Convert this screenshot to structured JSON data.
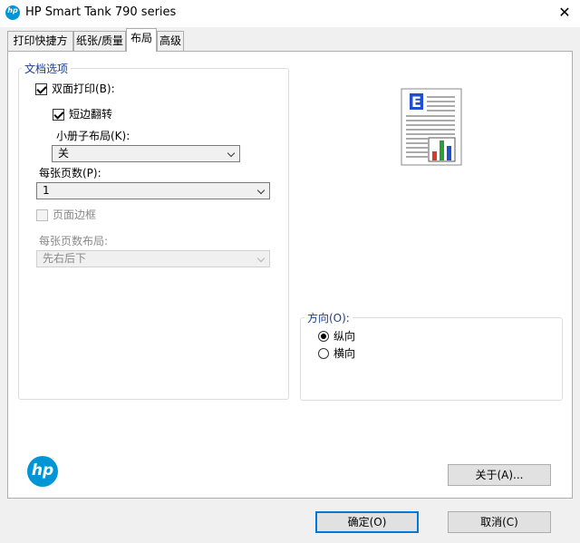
{
  "window": {
    "title": "HP Smart Tank 790 series",
    "logo_text": "hp"
  },
  "tabs": [
    {
      "label": "打印快捷方式"
    },
    {
      "label": "纸张/质量"
    },
    {
      "label": "布局"
    },
    {
      "label": "高级"
    }
  ],
  "active_tab": "布局",
  "doc_options": {
    "legend": "文档选项",
    "duplex": {
      "label": "双面打印(B):",
      "checked": true
    },
    "flip_short": {
      "label": "短边翻转",
      "checked": true
    },
    "booklet": {
      "label": "小册子布局(K):",
      "value": "关"
    },
    "pages_per_sheet": {
      "label": "每张页数(P):",
      "value": "1"
    },
    "page_borders": {
      "label": "页面边框",
      "checked": false,
      "enabled": false
    },
    "page_order": {
      "label": "每张页数布局:",
      "value": "先右后下",
      "enabled": false
    }
  },
  "preview": {
    "icon": "document-preview-icon",
    "letter": "E"
  },
  "orientation": {
    "legend": "方向(O):",
    "portrait": "纵向",
    "landscape": "横向",
    "selected": "portrait"
  },
  "buttons": {
    "about": "关于(A)...",
    "ok": "确定(O)",
    "cancel": "取消(C)"
  },
  "colors": {
    "accent": "#0078d7",
    "hp_blue": "#0096d6",
    "legend": "#1a3e8c"
  }
}
